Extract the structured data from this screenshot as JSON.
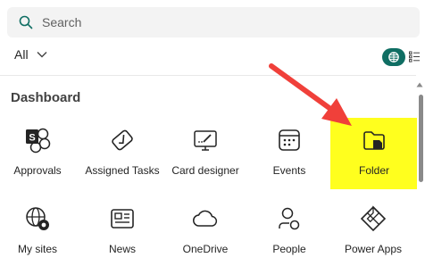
{
  "search": {
    "placeholder": "Search",
    "icon": "search-icon"
  },
  "filter": {
    "label": "All"
  },
  "view": {
    "grid_icon": "grid-icon",
    "list_icon": "list-icon",
    "accent": "#0f6e63"
  },
  "section": {
    "title": "Dashboard"
  },
  "tiles_row1": [
    {
      "label": "Approvals",
      "icon": "approvals-icon"
    },
    {
      "label": "Assigned Tasks",
      "icon": "assigned-tasks-icon"
    },
    {
      "label": "Card designer",
      "icon": "card-designer-icon"
    },
    {
      "label": "Events",
      "icon": "calendar-icon"
    },
    {
      "label": "Folder",
      "icon": "folder-icon"
    }
  ],
  "tiles_row2": [
    {
      "label": "My sites",
      "icon": "globe-icon"
    },
    {
      "label": "News",
      "icon": "news-icon"
    },
    {
      "label": "OneDrive",
      "icon": "cloud-icon"
    },
    {
      "label": "People",
      "icon": "people-icon"
    },
    {
      "label": "Power Apps",
      "icon": "power-apps-icon"
    }
  ],
  "annotation": {
    "highlight_color": "#ffff1e",
    "arrow_color": "#f0403a"
  }
}
